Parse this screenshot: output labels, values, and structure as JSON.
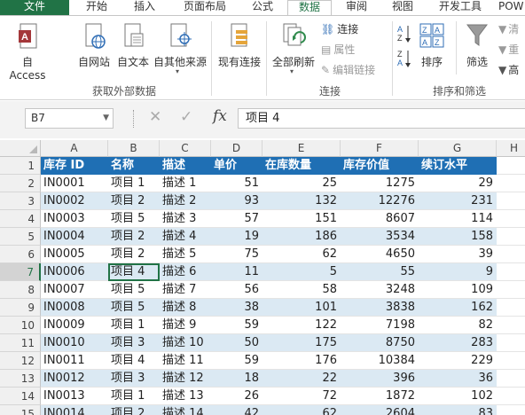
{
  "tabs": [
    "文件",
    "开始",
    "插入",
    "页面布局",
    "公式",
    "数据",
    "审阅",
    "视图",
    "开发工具",
    "POW"
  ],
  "active_tab": "数据",
  "ribbon": {
    "get_external": {
      "buttons": [
        "自 Access",
        "自网站",
        "自文本",
        "自其他来源",
        "现有连接"
      ],
      "label": "获取外部数据"
    },
    "connections": {
      "refresh_all": "全部刷新",
      "connections": "连接",
      "properties": "属性",
      "edit_links": "编辑链接",
      "label": "连接"
    },
    "sort_filter": {
      "sort": "排序",
      "filter": "筛选",
      "clear": "清",
      "reapply": "重",
      "advanced": "高",
      "label": "排序和筛选"
    }
  },
  "formula_bar": {
    "name_box": "B7",
    "fx": "fx",
    "value": "项目 4"
  },
  "columns": [
    "A",
    "B",
    "C",
    "D",
    "E",
    "F",
    "G",
    "H"
  ],
  "table": {
    "headers": [
      "库存 ID",
      "名称",
      "描述",
      "单价",
      "在库数量",
      "库存价值",
      "续订水平"
    ],
    "rows": [
      [
        "IN0001",
        "项目 1",
        "描述 1",
        "51",
        "25",
        "1275",
        "29"
      ],
      [
        "IN0002",
        "项目 2",
        "描述 2",
        "93",
        "132",
        "12276",
        "231"
      ],
      [
        "IN0003",
        "项目 5",
        "描述 3",
        "57",
        "151",
        "8607",
        "114"
      ],
      [
        "IN0004",
        "项目 2",
        "描述 4",
        "19",
        "186",
        "3534",
        "158"
      ],
      [
        "IN0005",
        "项目 2",
        "描述 5",
        "75",
        "62",
        "4650",
        "39"
      ],
      [
        "IN0006",
        "项目 4",
        "描述 6",
        "11",
        "5",
        "55",
        "9"
      ],
      [
        "IN0007",
        "项目 5",
        "描述 7",
        "56",
        "58",
        "3248",
        "109"
      ],
      [
        "IN0008",
        "项目 5",
        "描述 8",
        "38",
        "101",
        "3838",
        "162"
      ],
      [
        "IN0009",
        "项目 1",
        "描述 9",
        "59",
        "122",
        "7198",
        "82"
      ],
      [
        "IN0010",
        "项目 3",
        "描述 10",
        "50",
        "175",
        "8750",
        "283"
      ],
      [
        "IN0011",
        "项目 4",
        "描述 11",
        "59",
        "176",
        "10384",
        "229"
      ],
      [
        "IN0012",
        "项目 3",
        "描述 12",
        "18",
        "22",
        "396",
        "36"
      ],
      [
        "IN0013",
        "项目 1",
        "描述 13",
        "26",
        "72",
        "1872",
        "102"
      ],
      [
        "IN0014",
        "项目 2",
        "描述 14",
        "42",
        "62",
        "2604",
        "83"
      ]
    ]
  },
  "row_numbers": [
    "1",
    "2",
    "3",
    "4",
    "5",
    "6",
    "7",
    "8",
    "9",
    "10",
    "11",
    "12",
    "13",
    "14",
    "15"
  ],
  "colors": {
    "excel_green": "#217346",
    "header_blue": "#1f6fb4",
    "band_blue": "#dbe9f3"
  }
}
